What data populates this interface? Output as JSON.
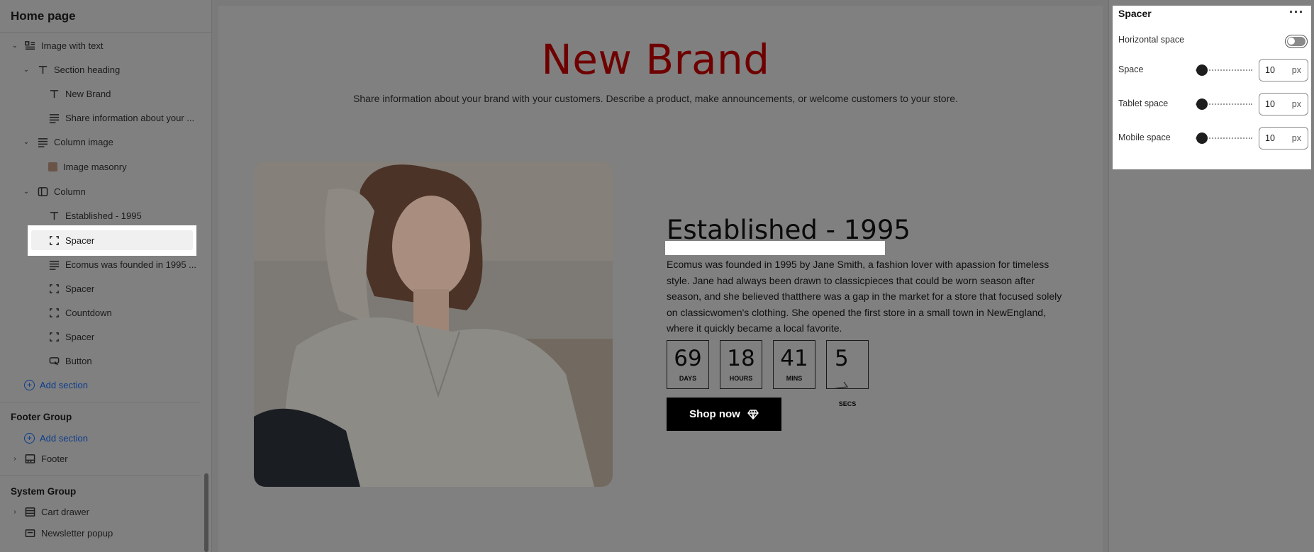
{
  "sidebar": {
    "title": "Home page",
    "tree": [
      {
        "label": "Image with text"
      },
      {
        "label": "Section heading"
      },
      {
        "label": "New Brand"
      },
      {
        "label": "Share information about your ..."
      },
      {
        "label": "Column image"
      },
      {
        "label": "Image masonry"
      },
      {
        "label": "Column"
      },
      {
        "label": "Established - 1995"
      },
      {
        "label": "Spacer"
      },
      {
        "label": "Ecomus was founded in 1995 ..."
      },
      {
        "label": "Spacer"
      },
      {
        "label": "Countdown"
      },
      {
        "label": "Spacer"
      },
      {
        "label": "Button"
      }
    ],
    "add_section_label": "Add section",
    "footer_group": {
      "title": "Footer Group",
      "add_section_label": "Add section",
      "items": [
        {
          "label": "Footer"
        }
      ]
    },
    "system_group": {
      "title": "System Group",
      "items": [
        {
          "label": "Cart drawer"
        },
        {
          "label": "Newsletter popup"
        }
      ]
    }
  },
  "canvas": {
    "brand_title": "New Brand",
    "brand_subtitle": "Share information about your brand with your customers. Describe a product, make announcements, or welcome customers to your store.",
    "established_title": "Established - 1995",
    "body_text": "Ecomus was founded in 1995 by Jane Smith, a fashion lover with apassion for timeless style. Jane had always been drawn to classicpieces that could be worn season after season, and she believed thatthere was a gap in the market for a store that focused solely on classicwomen's clothing. She opened the first store in a small town in NewEngland, where it quickly became a local favorite.",
    "countdown": [
      {
        "value": "69",
        "label": "DAYS"
      },
      {
        "value": "18",
        "label": "HOURS"
      },
      {
        "value": "41",
        "label": "MINS"
      },
      {
        "value": "5",
        "label": "SECS"
      }
    ],
    "button_label": "Shop now"
  },
  "panel": {
    "title": "Spacer",
    "horizontal_space_label": "Horizontal space",
    "horizontal_space_enabled": false,
    "rows": [
      {
        "label": "Space",
        "value": "10",
        "unit": "px"
      },
      {
        "label": "Tablet space",
        "value": "10",
        "unit": "px"
      },
      {
        "label": "Mobile space",
        "value": "10",
        "unit": "px"
      }
    ]
  },
  "colors": {
    "brand_title": "#6e0000",
    "accent_link": "#0b3c8c",
    "button_bg": "#000000"
  }
}
